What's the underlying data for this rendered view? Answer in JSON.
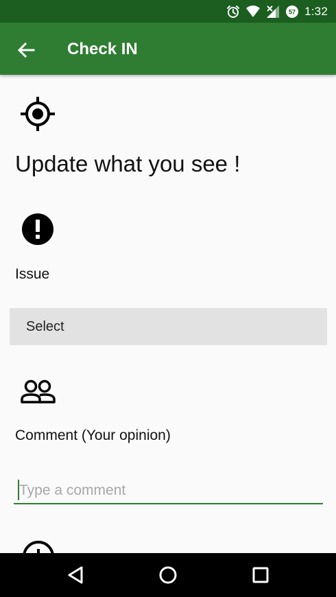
{
  "status_bar": {
    "time": "1:32",
    "battery_level": "57",
    "icons": [
      "alarm-icon",
      "wifi-icon",
      "signal-icon",
      "battery-icon"
    ]
  },
  "app_bar": {
    "title": "Check IN",
    "back_icon": "arrow-back-icon",
    "color": "#2e7d32",
    "status_color": "#1b5e20"
  },
  "main": {
    "headline": "Update what you see !",
    "location_icon": "crosshair-icon",
    "issue": {
      "icon": "alert-icon",
      "label": "Issue",
      "select_value": "Select"
    },
    "comment": {
      "icon": "people-icon",
      "label": "Comment (Your opinion)",
      "placeholder": "Type a comment",
      "value": ""
    },
    "next_section_icon": "add-circle-icon"
  },
  "nav_bar": {
    "back": "nav-back-icon",
    "home": "nav-home-icon",
    "recents": "nav-recents-icon"
  }
}
